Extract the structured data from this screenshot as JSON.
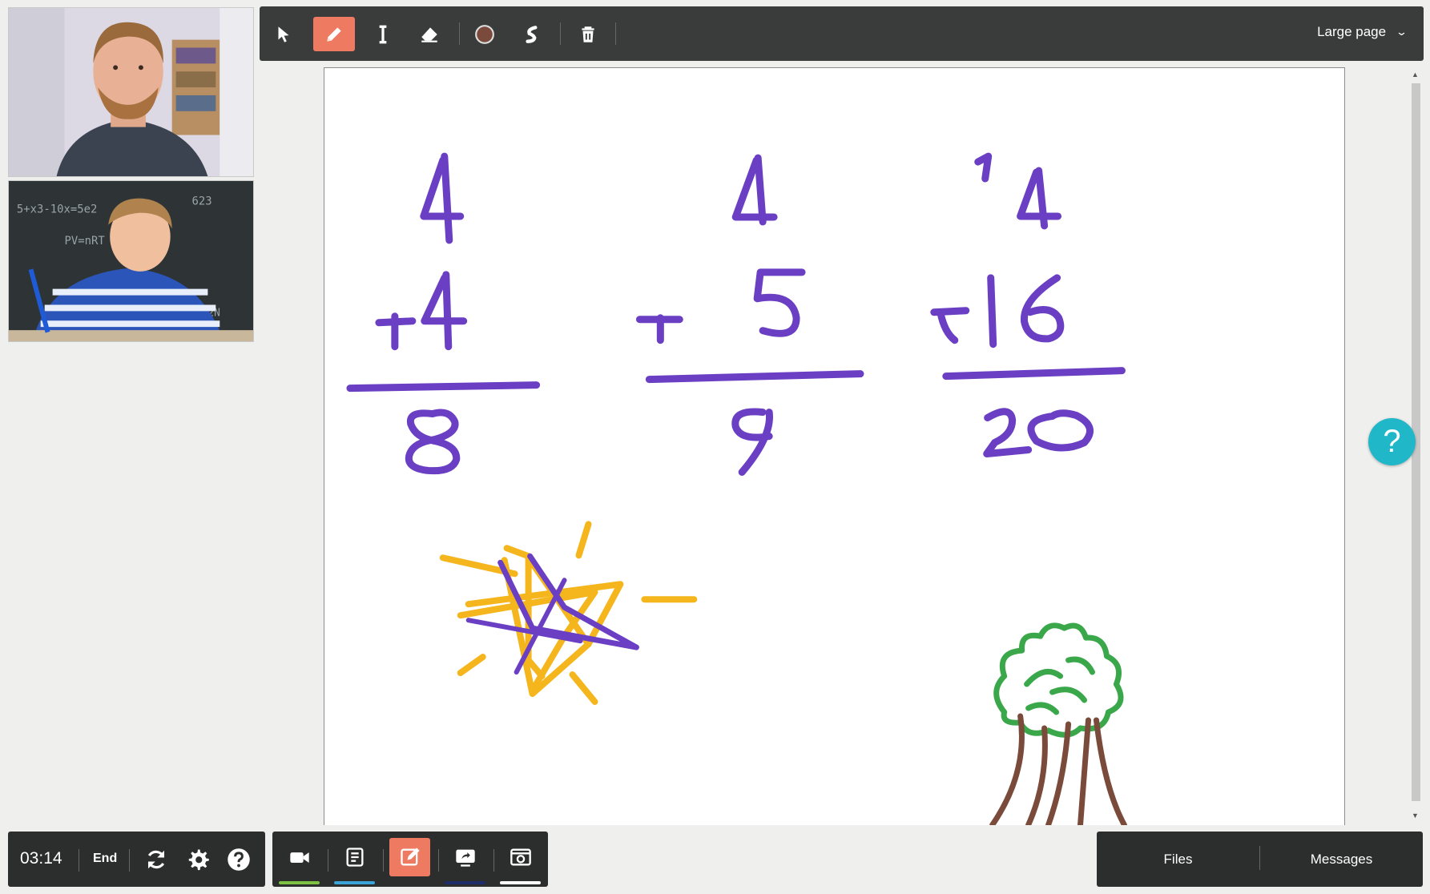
{
  "toolbar": {
    "tools": [
      "select",
      "pen",
      "text",
      "eraser",
      "color",
      "line-width",
      "delete"
    ],
    "active_tool": "pen",
    "pen_color": "#7a4a3c",
    "page_size_label": "Large page"
  },
  "session": {
    "timer": "03:14",
    "end_label": "End"
  },
  "modes": {
    "items": [
      "video",
      "notes",
      "whiteboard",
      "screen-share",
      "snapshot"
    ],
    "active": "whiteboard",
    "indicator_colors": [
      "#7cc142",
      "#3aa3d8",
      "",
      "#1c2d6a",
      "#ffffff"
    ]
  },
  "panels": {
    "files_label": "Files",
    "messages_label": "Messages"
  },
  "help": {
    "fab_label": "?"
  },
  "whiteboard": {
    "problems": [
      {
        "top": "4",
        "bottom": "+4",
        "sum": "8"
      },
      {
        "top": "4",
        "bottom": "+ 5",
        "sum": "9"
      },
      {
        "carry": "1",
        "top": "4",
        "bottom": "+16",
        "sum": "20"
      }
    ],
    "ink_colors": {
      "math": "#6a3fc4",
      "sun": "#f5b51c",
      "tree_leaves": "#3aa84a",
      "tree_trunk": "#7a4a3a"
    }
  }
}
